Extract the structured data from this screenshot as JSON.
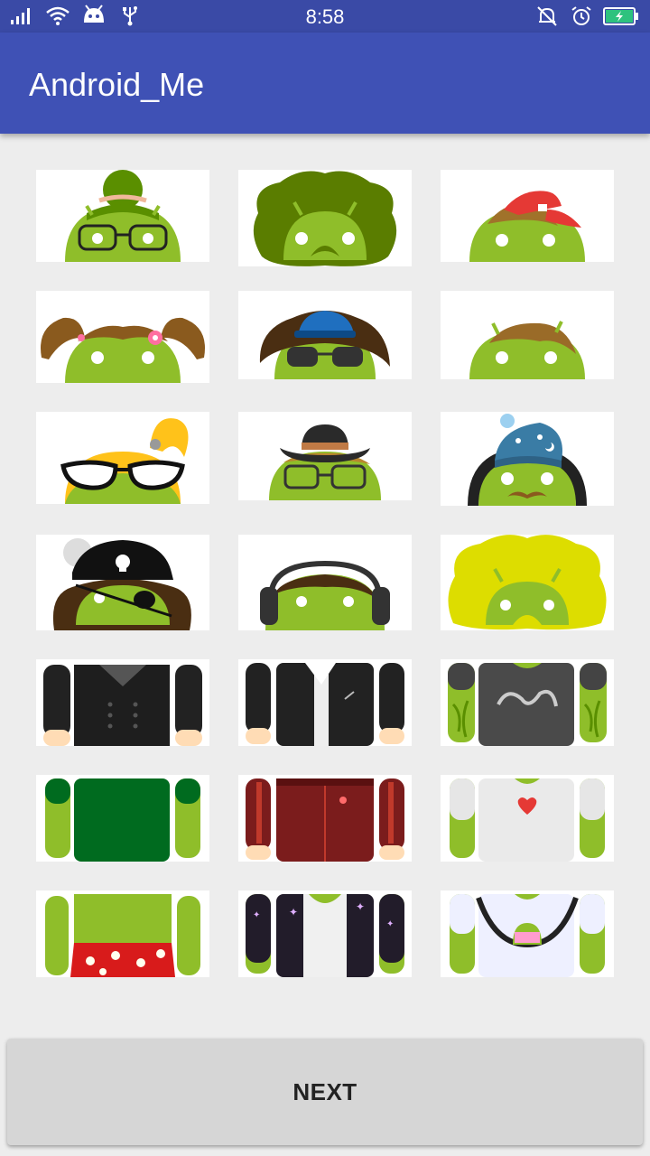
{
  "status_bar": {
    "time": "8:58",
    "icons_left": [
      "signal-icon",
      "wifi-icon",
      "android-notification-icon",
      "usb-icon"
    ],
    "icons_right": [
      "alarm-off-icon",
      "alarm-clock-icon",
      "battery-charging-icon"
    ]
  },
  "app_bar": {
    "title": "Android_Me"
  },
  "colors": {
    "app_bar": "#3f51b5",
    "status_bar": "#3a4aa6",
    "android_green": "#8fbe2a",
    "background": "#ededed"
  },
  "grid": {
    "tiles": [
      {
        "name": "head-bun-glasses",
        "kind": "head"
      },
      {
        "name": "head-afro",
        "kind": "head"
      },
      {
        "name": "head-red-cap",
        "kind": "head"
      },
      {
        "name": "head-pigtails",
        "kind": "head"
      },
      {
        "name": "head-blue-cap-sunglasses",
        "kind": "head"
      },
      {
        "name": "head-brown-hair",
        "kind": "head"
      },
      {
        "name": "head-blonde-cat-eye-glasses",
        "kind": "head"
      },
      {
        "name": "head-cowboy-hat",
        "kind": "head"
      },
      {
        "name": "head-wizard-hat-mustache",
        "kind": "head"
      },
      {
        "name": "head-pirate",
        "kind": "head"
      },
      {
        "name": "head-headphones",
        "kind": "head"
      },
      {
        "name": "head-yellow-afro",
        "kind": "head"
      },
      {
        "name": "body-black-jacket",
        "kind": "body"
      },
      {
        "name": "body-leather-jacket",
        "kind": "body"
      },
      {
        "name": "body-graffiti-tshirt",
        "kind": "body"
      },
      {
        "name": "body-green-shirt",
        "kind": "body"
      },
      {
        "name": "body-red-track-jacket",
        "kind": "body"
      },
      {
        "name": "body-heart-tshirt",
        "kind": "body"
      },
      {
        "name": "body-hawaiian-shorts",
        "kind": "body"
      },
      {
        "name": "body-sparkle-jacket",
        "kind": "body"
      },
      {
        "name": "body-android-overalls",
        "kind": "body"
      }
    ]
  },
  "next_button": {
    "label": "NEXT"
  }
}
